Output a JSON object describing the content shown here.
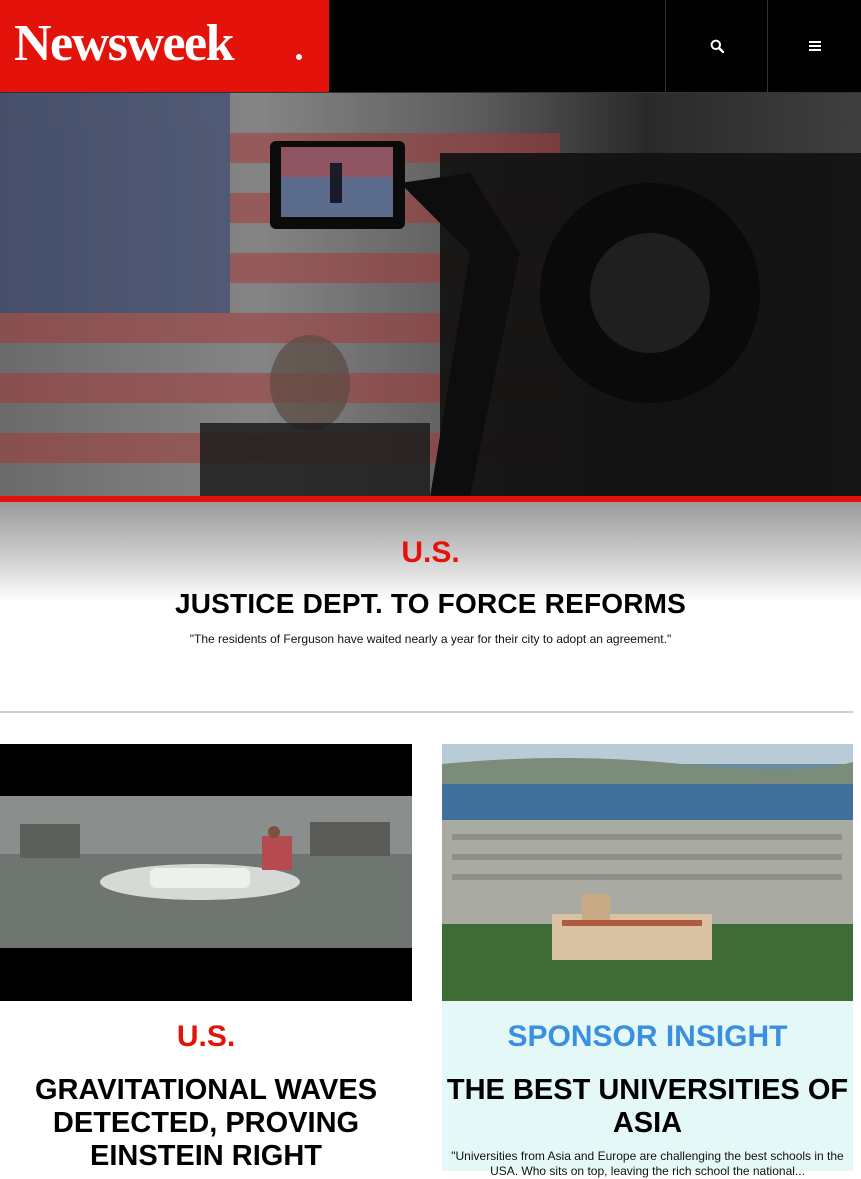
{
  "header": {
    "logo_text": "Newsweek",
    "search_icon": "search-icon",
    "menu_icon": "hamburger-menu-icon"
  },
  "colors": {
    "brand_red": "#e3120b",
    "sponsor_blue": "#3b8fe0",
    "sponsor_bg": "#e5f8f8",
    "header_bg": "#000000"
  },
  "hero": {
    "section": "U.S.",
    "title": "JUSTICE DEPT. TO FORCE REFORMS",
    "quote": "\"The residents of Ferguson have waited nearly a year for their city to adopt an agreement.\""
  },
  "cards": [
    {
      "section": "U.S.",
      "title": "GRAVITATIONAL WAVES DETECTED, PROVING EINSTEIN RIGHT"
    },
    {
      "section": "SPONSOR INSIGHT",
      "title": "THE BEST UNIVERSITIES OF ASIA",
      "quote": "\"Universities from Asia and Europe are challenging the best schools in the USA. Who sits on top, leaving the rich school the national..."
    }
  ]
}
